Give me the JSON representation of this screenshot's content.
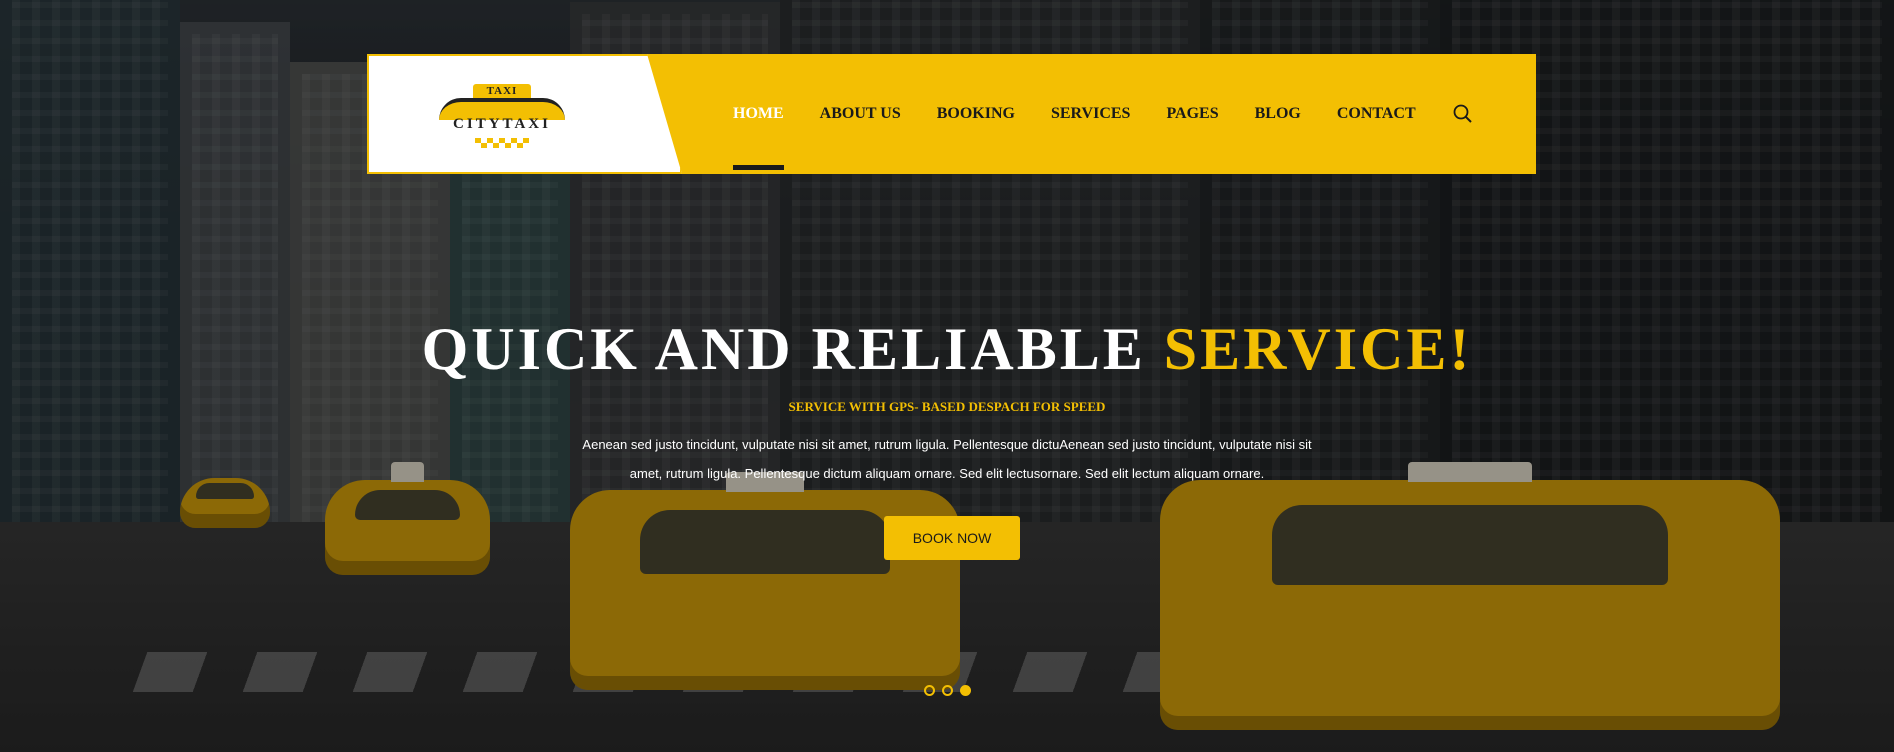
{
  "brand": {
    "logo_top": "TAXI",
    "logo_name": "CITYTAXI"
  },
  "nav": {
    "items": [
      {
        "label": "HOME",
        "active": true
      },
      {
        "label": "ABOUT US",
        "active": false
      },
      {
        "label": "BOOKING",
        "active": false
      },
      {
        "label": "SERVICES",
        "active": false
      },
      {
        "label": "PAGES",
        "active": false
      },
      {
        "label": "BLOG",
        "active": false
      },
      {
        "label": "CONTACT",
        "active": false
      }
    ],
    "search_icon": "search-icon"
  },
  "hero": {
    "title_main": "QUICK AND RELIABLE ",
    "title_accent": "SERVICE!",
    "subtitle": "SERVICE WITH GPS- BASED DESPACH FOR SPEED",
    "description": "Aenean sed justo tincidunt, vulputate nisi sit amet, rutrum ligula. Pellentesque dictuAenean sed justo tincidunt, vulputate nisi sit amet, rutrum ligula. Pellentesque dictum aliquam ornare. Sed elit lectusornare. Sed elit lectum aliquam ornare.",
    "cta_label": "BOOK NOW"
  },
  "slider": {
    "count": 3,
    "active_index": 2
  },
  "colors": {
    "accent": "#f3bf03",
    "dark": "#1a1a1a",
    "white": "#ffffff"
  }
}
